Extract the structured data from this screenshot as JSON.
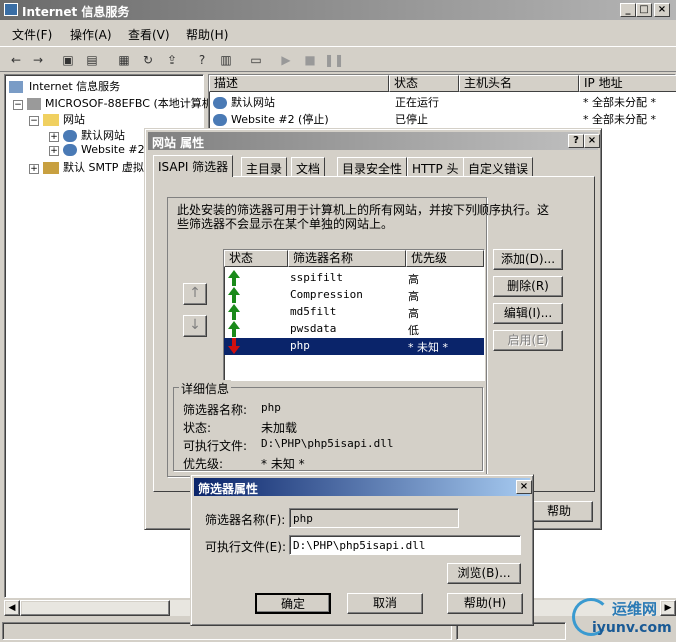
{
  "app": {
    "title": "Internet 信息服务"
  },
  "menu": [
    "文件(F)",
    "操作(A)",
    "查看(V)",
    "帮助(H)"
  ],
  "tree": {
    "root": "Internet 信息服务",
    "computer": "MICROSOF-88EFBC (本地计算机",
    "sites": "网站",
    "default_site": "默认网站",
    "website2": "Website #2",
    "smtp": "默认 SMTP 虚拟"
  },
  "list": {
    "headers": [
      "描述",
      "状态",
      "主机头名",
      "IP 地址"
    ],
    "rows": [
      {
        "desc": "默认网站",
        "status": "正在运行",
        "host": "",
        "ip": "* 全部未分配 *"
      },
      {
        "desc": "Website #2 (停止)",
        "status": "已停止",
        "host": "",
        "ip": "* 全部未分配 *"
      }
    ]
  },
  "props": {
    "title": "网站 属性",
    "tabs": [
      "ISAPI 筛选器",
      "主目录",
      "文档",
      "目录安全性",
      "HTTP 头",
      "自定义错误"
    ],
    "description": "此处安装的筛选器可用于计算机上的所有网站，并按下列顺序执行。这些筛选器不会显示在某个单独的网站上。",
    "filter_headers": [
      "状态",
      "筛选器名称",
      "优先级"
    ],
    "filters": [
      {
        "name": "sspifilt",
        "priority": "高"
      },
      {
        "name": "Compression",
        "priority": "高"
      },
      {
        "name": "md5filt",
        "priority": "高"
      },
      {
        "name": "pwsdata",
        "priority": "低"
      },
      {
        "name": "php",
        "priority": "* 未知 *"
      }
    ],
    "buttons": {
      "add": "添加(D)...",
      "delete": "删除(R)",
      "edit": "编辑(I)...",
      "enable": "启用(E)"
    },
    "details": {
      "group": "详细信息",
      "name_label": "筛选器名称:",
      "name_value": "php",
      "status_label": "状态:",
      "status_value": "未加载",
      "exe_label": "可执行文件:",
      "exe_value": "D:\\PHP\\php5isapi.dll",
      "priority_label": "优先级:",
      "priority_value": "* 未知 *"
    },
    "help_button": "帮助"
  },
  "filter_dialog": {
    "title": "筛选器属性",
    "name_label": "筛选器名称(F):",
    "name_value": "php",
    "exe_label": "可执行文件(E):",
    "exe_value": "D:\\PHP\\php5isapi.dll",
    "browse": "浏览(B)...",
    "ok": "确定",
    "cancel": "取消",
    "help": "帮助(H)"
  },
  "watermark": {
    "text1": "运维网",
    "text2": "iyunv.com"
  }
}
